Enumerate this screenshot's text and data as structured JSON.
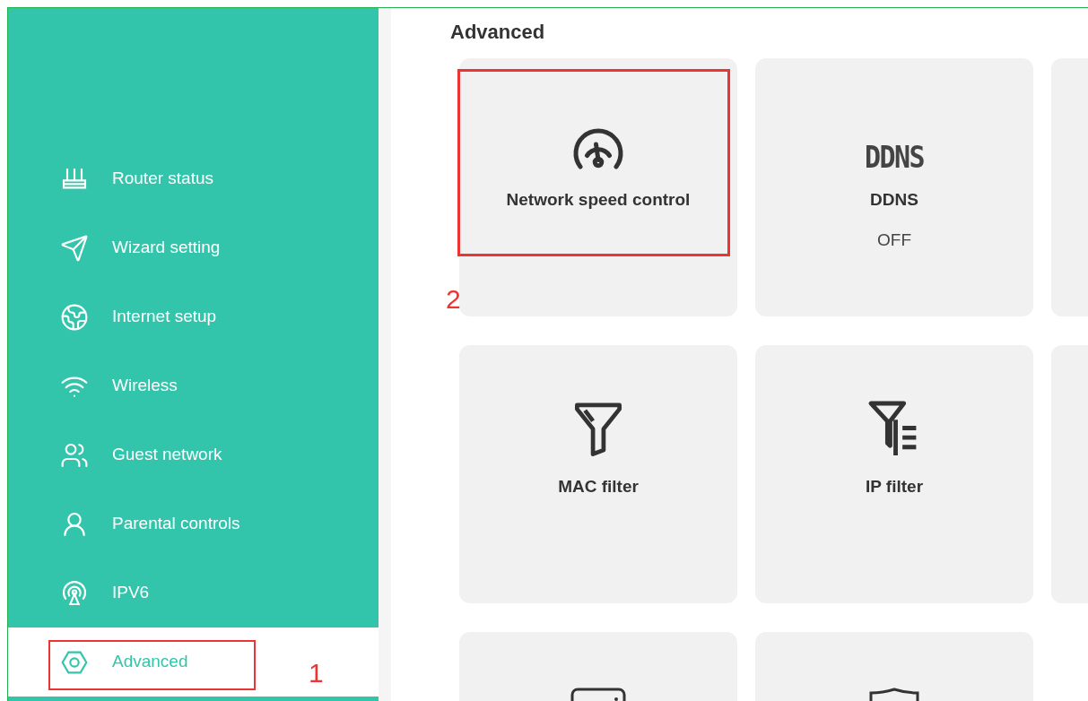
{
  "sidebar": {
    "items": [
      {
        "label": "Router status",
        "kind": "router",
        "selected": false
      },
      {
        "label": "Wizard setting",
        "kind": "send",
        "selected": false
      },
      {
        "label": "Internet setup",
        "kind": "globe",
        "selected": false
      },
      {
        "label": "Wireless",
        "kind": "wifi",
        "selected": false
      },
      {
        "label": "Guest network",
        "kind": "users",
        "selected": false
      },
      {
        "label": "Parental controls",
        "kind": "user",
        "selected": false
      },
      {
        "label": "IPV6",
        "kind": "antenna",
        "selected": false
      },
      {
        "label": "Advanced",
        "kind": "hexagon",
        "selected": true,
        "annotation": "1"
      }
    ]
  },
  "main": {
    "title": "Advanced",
    "cards": [
      {
        "kind": "gauge",
        "label": "Network speed control",
        "annotation": "2"
      },
      {
        "kind": "ddns",
        "icon_text": "DDNS",
        "label": "DDNS",
        "status": "OFF"
      },
      {
        "kind": "blank"
      },
      {
        "kind": "funnel",
        "label": "MAC filter"
      },
      {
        "kind": "funnel-list",
        "label": "IP filter"
      },
      {
        "kind": "blank"
      },
      {
        "kind": "drive"
      },
      {
        "kind": "shield"
      }
    ]
  }
}
